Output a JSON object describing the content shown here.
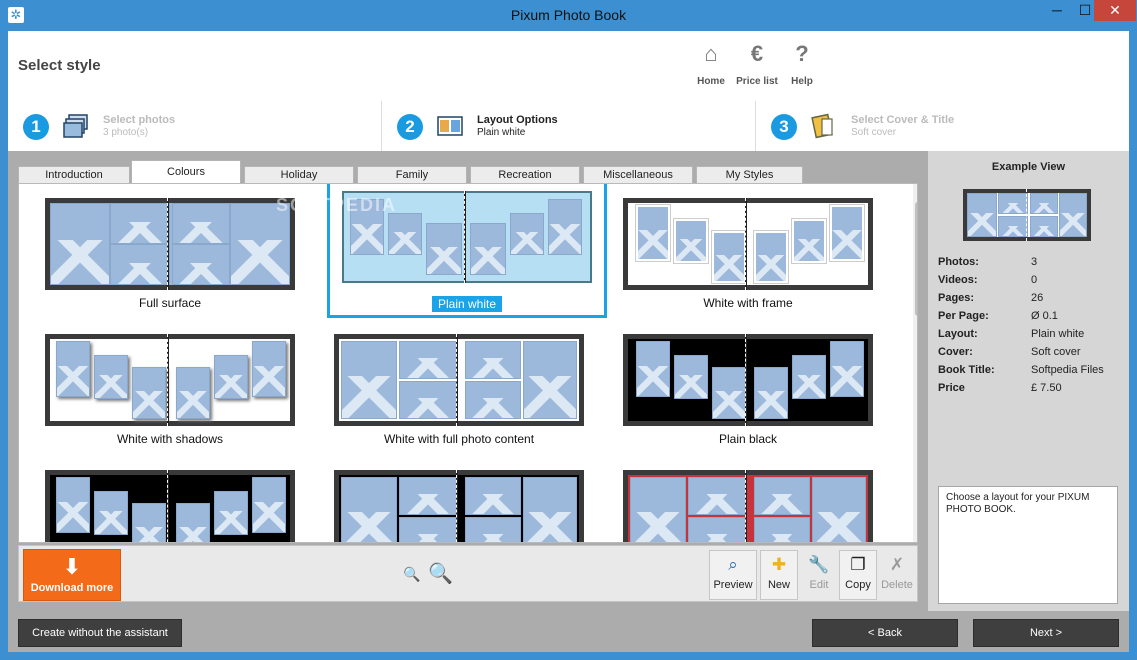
{
  "window": {
    "title": "Pixum Photo Book",
    "close_glyph": "✕",
    "min_glyph": "─",
    "max_glyph": "☐"
  },
  "heading": "Select style",
  "topbar": {
    "home": "Home",
    "price": "Price list",
    "help": "Help"
  },
  "steps": [
    {
      "num": "1",
      "title": "Select photos",
      "sub": "3 photo(s)"
    },
    {
      "num": "2",
      "title": "Layout Options",
      "sub": "Plain white"
    },
    {
      "num": "3",
      "title": "Select Cover & Title",
      "sub": "Soft cover"
    }
  ],
  "tabs": [
    "Introduction",
    "Colours",
    "Holiday",
    "Family",
    "Recreation",
    "Miscellaneous",
    "My Styles"
  ],
  "active_tab": "Colours",
  "styles": [
    {
      "label": "Full surface"
    },
    {
      "label": "Plain white"
    },
    {
      "label": "White with frame"
    },
    {
      "label": "White with shadows"
    },
    {
      "label": "White with full photo content"
    },
    {
      "label": "Plain black"
    },
    {
      "label": ""
    },
    {
      "label": ""
    },
    {
      "label": ""
    }
  ],
  "selected_style": "Plain white",
  "toolbar": {
    "download": "Download more",
    "preview": "Preview",
    "new": "New",
    "edit": "Edit",
    "copy": "Copy",
    "delete": "Delete"
  },
  "side": {
    "title": "Example View",
    "info": [
      {
        "k": "Photos:",
        "v": "3"
      },
      {
        "k": "Videos:",
        "v": "0"
      },
      {
        "k": "Pages:",
        "v": "26"
      },
      {
        "k": "Per Page:",
        "v": "Ø 0.1"
      },
      {
        "k": "Layout:",
        "v": "Plain white"
      },
      {
        "k": "Cover:",
        "v": "Soft cover"
      },
      {
        "k": "Book Title:",
        "v": "Softpedia Files"
      },
      {
        "k": "Price",
        "v": "£ 7.50"
      }
    ],
    "help": "Choose a layout for your PIXUM PHOTO BOOK."
  },
  "buttons": {
    "no_assist": "Create without the assistant",
    "back": "< Back",
    "next": "Next >"
  },
  "watermark": "SOFTPEDIA",
  "colors": {
    "accent": "#1aa3e6",
    "download": "#f36a18",
    "title_bar": "#3c8fd0"
  }
}
